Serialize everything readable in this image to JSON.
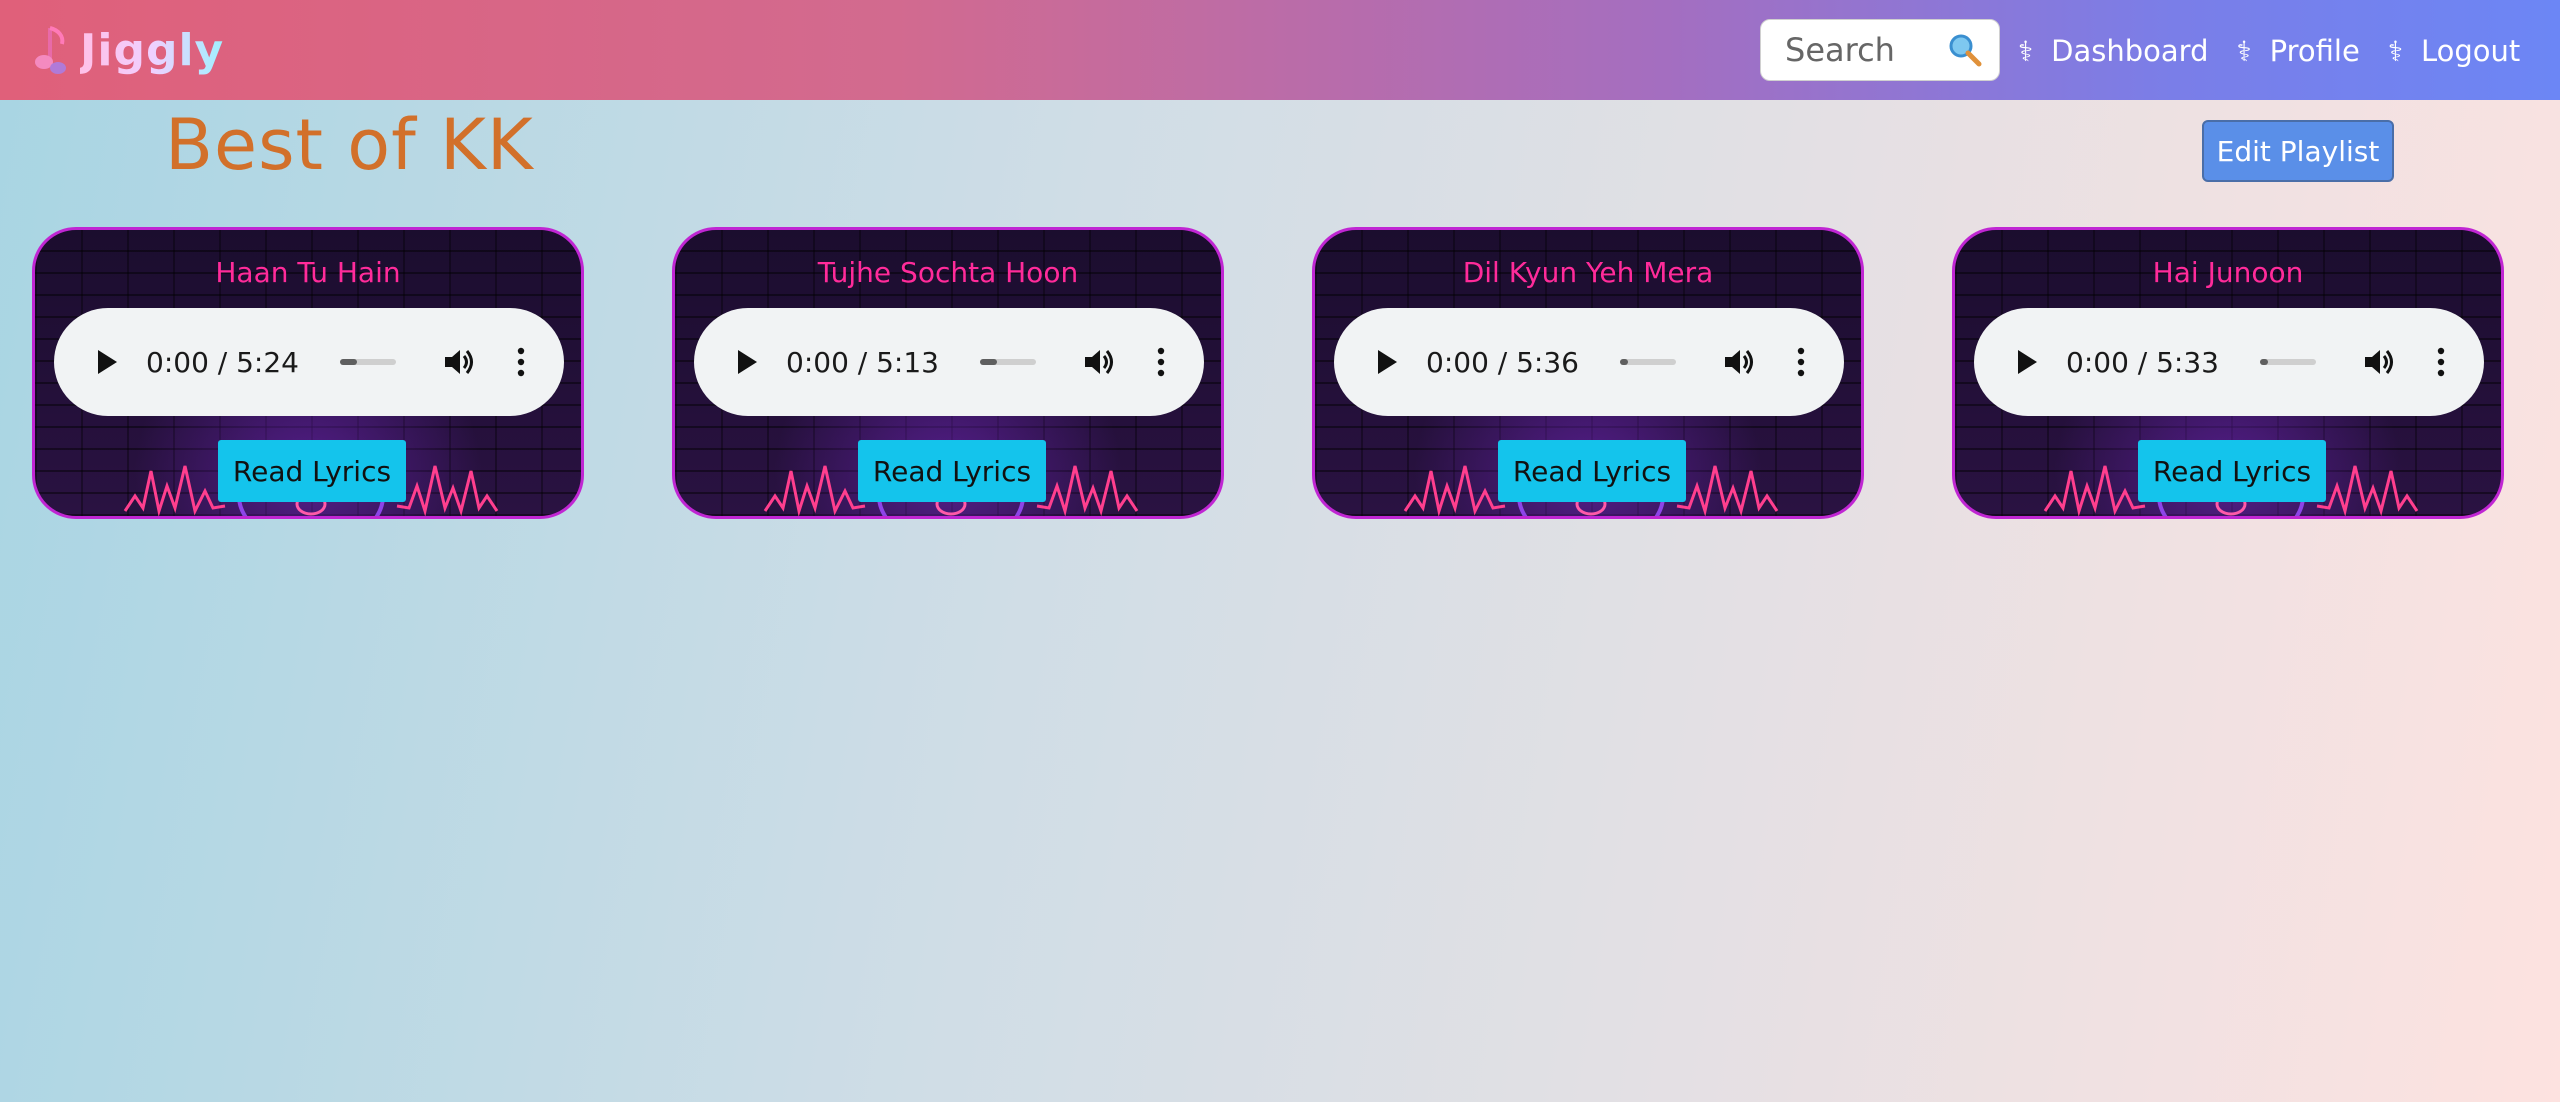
{
  "navbar": {
    "brand": "Jiggly",
    "search_placeholder": "Search",
    "links": [
      {
        "label": "Dashboard",
        "symbol": "⚕"
      },
      {
        "label": "Profile",
        "symbol": "⚕"
      },
      {
        "label": "Logout",
        "symbol": "⚕"
      }
    ]
  },
  "playlist": {
    "title": "Best of KK",
    "edit_label": "Edit Playlist"
  },
  "songs": [
    {
      "title": "Haan Tu Hain",
      "time": "0:00 / 5:24",
      "lyrics_label": "Read Lyrics",
      "progress": 0.3
    },
    {
      "title": "Tujhe Sochta Hoon",
      "time": "0:00 / 5:13",
      "lyrics_label": "Read Lyrics",
      "progress": 0.3
    },
    {
      "title": "Dil Kyun Yeh Mera",
      "time": "0:00 / 5:36",
      "lyrics_label": "Read Lyrics",
      "progress": 0.15
    },
    {
      "title": "Hai Junoon",
      "time": "0:00 / 5:33",
      "lyrics_label": "Read Lyrics",
      "progress": 0.15
    }
  ],
  "colors": {
    "title": "#d2702a",
    "card_border": "#c026d3",
    "card_title": "#ff2b9a",
    "lyrics_button": "#14c4ec",
    "edit_button": "#5a8fe8"
  },
  "icons": {
    "brand": "music-note-icon",
    "search": "magnifier-icon",
    "play": "play-icon",
    "volume": "volume-icon",
    "more": "more-vertical-icon"
  }
}
